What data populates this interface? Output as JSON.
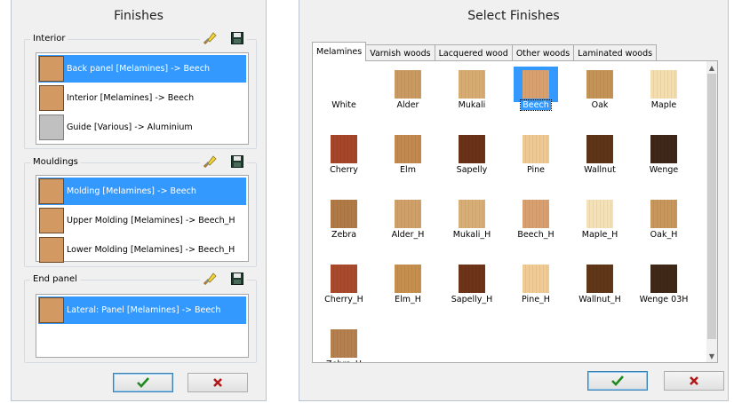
{
  "finishes_window": {
    "title": "Finishes",
    "groups": [
      {
        "label": "Interior",
        "items": [
          {
            "text": "Back panel [Melamines] -> Beech",
            "selected": true,
            "swatch": "#d29a62"
          },
          {
            "text": "Interior [Melamines] -> Beech",
            "selected": false,
            "swatch": "#d29a62"
          },
          {
            "text": "Guide [Various] -> Aluminium",
            "selected": false,
            "swatch": "#c0c0c0"
          }
        ]
      },
      {
        "label": "Mouldings",
        "items": [
          {
            "text": "Molding [Melamines] -> Beech",
            "selected": true,
            "swatch": "#d29a62"
          },
          {
            "text": "Upper Molding [Melamines] -> Beech_H",
            "selected": false,
            "swatch": "#d29a62"
          },
          {
            "text": "Lower Molding [Melamines] -> Beech_H",
            "selected": false,
            "swatch": "#d29a62"
          }
        ]
      },
      {
        "label": "End panel",
        "items": [
          {
            "text": "Lateral: Panel [Melamines] -> Beech",
            "selected": true,
            "swatch": "#d29a62"
          }
        ]
      }
    ],
    "ok_icon": "check-icon",
    "cancel_icon": "x-icon"
  },
  "select_window": {
    "title": "Select Finishes",
    "tabs": [
      "Melamines",
      "Varnish woods",
      "Lacquered wood",
      "Other woods",
      "Laminated woods"
    ],
    "active_tab": 0,
    "finishes": [
      {
        "name": "White",
        "color": "#ffffff",
        "selected": false
      },
      {
        "name": "Alder",
        "color": "#c99a62",
        "selected": false
      },
      {
        "name": "Mukali",
        "color": "#d7ac72",
        "selected": false
      },
      {
        "name": "Beech",
        "color": "#d9a070",
        "selected": true
      },
      {
        "name": "Oak",
        "color": "#c49358",
        "selected": false
      },
      {
        "name": "Maple",
        "color": "#f4deb0",
        "selected": false
      },
      {
        "name": "Cherry",
        "color": "#a5452a",
        "selected": false
      },
      {
        "name": "Elm",
        "color": "#c1894f",
        "selected": false
      },
      {
        "name": "Sapelly",
        "color": "#6a3218",
        "selected": false
      },
      {
        "name": "Pine",
        "color": "#efc993",
        "selected": false
      },
      {
        "name": "Wallnut",
        "color": "#5d3418",
        "selected": false
      },
      {
        "name": "Wenge",
        "color": "#3e2618",
        "selected": false
      },
      {
        "name": "Zebra",
        "color": "#b07a48",
        "selected": false
      },
      {
        "name": "Alder_H",
        "color": "#cfa06a",
        "selected": false
      },
      {
        "name": "Mukali_H",
        "color": "#d8ae78",
        "selected": false
      },
      {
        "name": "Beech_H",
        "color": "#d8a070",
        "selected": false
      },
      {
        "name": "Maple_H",
        "color": "#f4e1b8",
        "selected": false
      },
      {
        "name": "Oak_H",
        "color": "#c7975e",
        "selected": false
      },
      {
        "name": "Cherry_H",
        "color": "#a84a2e",
        "selected": false
      },
      {
        "name": "Elm_H",
        "color": "#c5904f",
        "selected": false
      },
      {
        "name": "Sapelly_H",
        "color": "#6e3419",
        "selected": false
      },
      {
        "name": "Pine_H",
        "color": "#f0cb95",
        "selected": false
      },
      {
        "name": "Wallnut_H",
        "color": "#603719",
        "selected": false
      },
      {
        "name": "Wenge 03H",
        "color": "#3f2818",
        "selected": false
      },
      {
        "name": "Zebra_H",
        "color": "#b58050",
        "selected": false
      }
    ],
    "ok_icon": "check-icon",
    "cancel_icon": "x-icon"
  },
  "colors": {
    "selection": "#3399ff",
    "ok_green": "#1f8a1f",
    "cancel_red": "#b01818"
  }
}
